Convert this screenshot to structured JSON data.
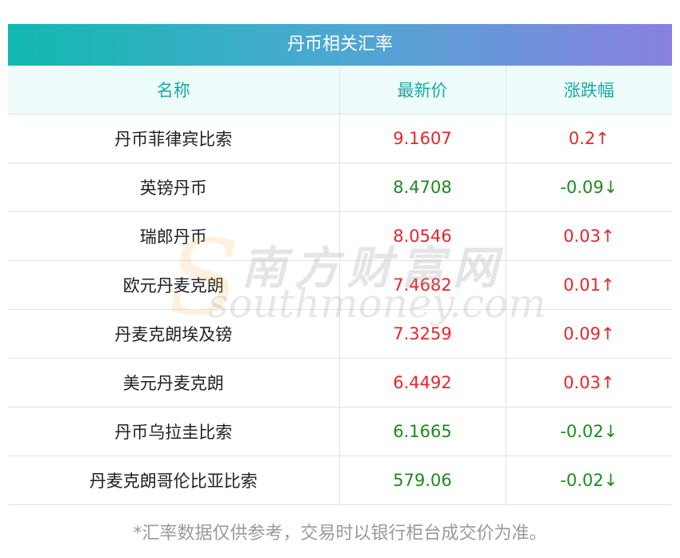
{
  "title": "丹币相关汇率",
  "columns": {
    "name": "名称",
    "price": "最新价",
    "change": "涨跌幅"
  },
  "rows": [
    {
      "name": "丹币菲律宾比索",
      "price": "9.1607",
      "change": "0.2↑",
      "direction": "up"
    },
    {
      "name": "英镑丹币",
      "price": "8.4708",
      "change": "-0.09↓",
      "direction": "down"
    },
    {
      "name": "瑞郎丹币",
      "price": "8.0546",
      "change": "0.03↑",
      "direction": "up"
    },
    {
      "name": "欧元丹麦克朗",
      "price": "7.4682",
      "change": "0.01↑",
      "direction": "up"
    },
    {
      "name": "丹麦克朗埃及镑",
      "price": "7.3259",
      "change": "0.09↑",
      "direction": "up"
    },
    {
      "name": "美元丹麦克朗",
      "price": "6.4492",
      "change": "0.03↑",
      "direction": "up"
    },
    {
      "name": "丹币乌拉圭比索",
      "price": "6.1665",
      "change": "-0.02↓",
      "direction": "down"
    },
    {
      "name": "丹麦克朗哥伦比亚比索",
      "price": "579.06",
      "change": "-0.02↓",
      "direction": "down"
    }
  ],
  "watermark": {
    "cn": "南方财富网",
    "en": "southmoney.com",
    "logo_letter": "S"
  },
  "footnote": "*汇率数据仅供参考，交易时以银行柜台成交价为准。",
  "colors": {
    "up": "#e8262b",
    "down": "#1f8a1f",
    "header_text": "#1aa9a3",
    "header_bg": "#eefcfc",
    "title_gradient_start": "#12b8b0",
    "title_gradient_end": "#8a7fe0"
  }
}
